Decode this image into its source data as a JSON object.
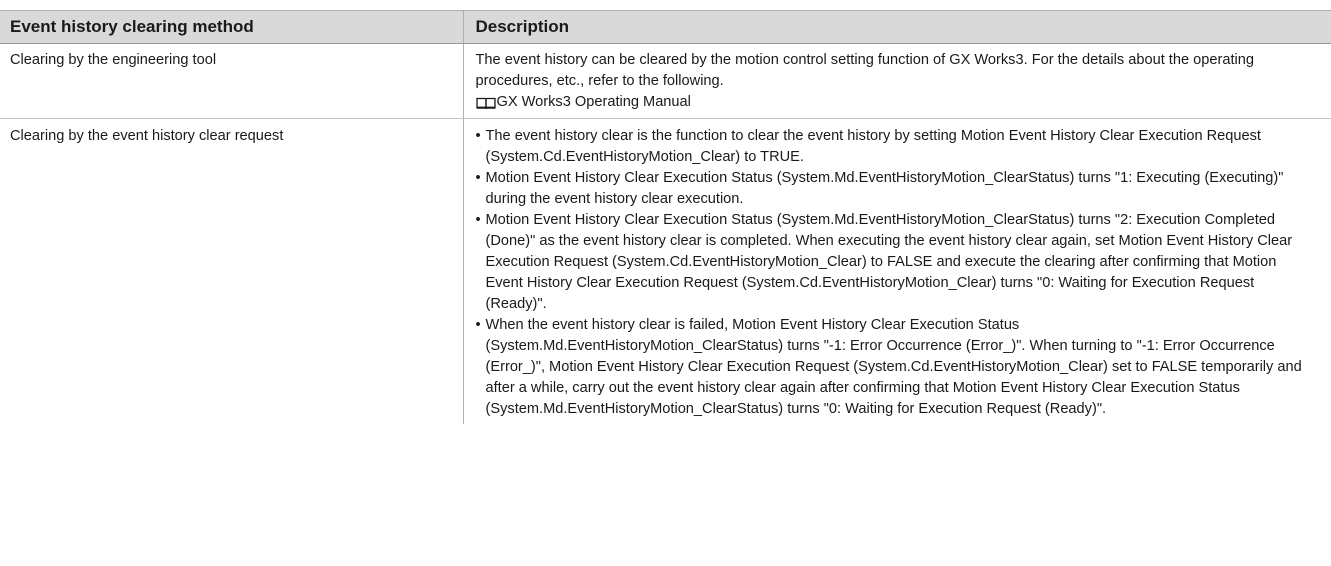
{
  "table": {
    "headers": [
      "Event history clearing method",
      "Description"
    ],
    "rows": [
      {
        "method": "Clearing by the engineering tool",
        "description": "The event history can be cleared by the motion control setting function of GX Works3. For the details about the operating procedures, etc., refer to the following.",
        "reference_icon": "manual-book-icon",
        "reference": "GX Works3 Operating Manual"
      },
      {
        "method": "Clearing by the event history clear request",
        "bullet_glyph": "•",
        "bullets": [
          "The event history clear is the function to clear the event history by setting Motion Event History Clear Execution Request (System.Cd.EventHistoryMotion_Clear) to TRUE.",
          "Motion Event History Clear Execution Status (System.Md.EventHistoryMotion_ClearStatus) turns \"1: Executing (Executing)\" during the event history clear execution.",
          "Motion Event History Clear Execution Status (System.Md.EventHistoryMotion_ClearStatus) turns \"2: Execution Completed (Done)\" as the event history clear is completed. When executing the event history clear again, set Motion Event History Clear Execution Request (System.Cd.EventHistoryMotion_Clear) to FALSE and execute the clearing after confirming that Motion Event History Clear Execution Request (System.Cd.EventHistoryMotion_Clear) turns \"0: Waiting for Execution Request (Ready)\".",
          "When the event history clear is failed, Motion Event History Clear Execution Status (System.Md.EventHistoryMotion_ClearStatus) turns \"-1: Error Occurrence (Error_)\". When turning to \"-1: Error Occurrence (Error_)\", Motion Event History Clear Execution Request (System.Cd.EventHistoryMotion_Clear) set to FALSE temporarily and after a while, carry out the event history clear again after confirming that Motion Event History Clear Execution Status (System.Md.EventHistoryMotion_ClearStatus) turns \"0: Waiting for Execution Request (Ready)\"."
        ]
      }
    ]
  }
}
